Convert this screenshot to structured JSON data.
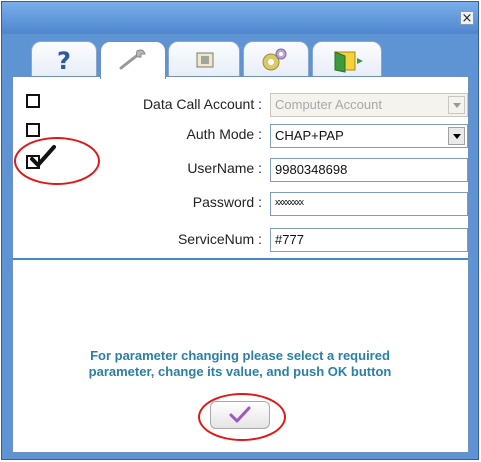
{
  "window": {
    "close_glyph": "×"
  },
  "tabs": [
    {
      "name": "help",
      "icon": "question-icon"
    },
    {
      "name": "settings",
      "icon": "wrench-icon",
      "active": true
    },
    {
      "name": "sim",
      "icon": "card-icon"
    },
    {
      "name": "advanced",
      "icon": "gears-icon"
    },
    {
      "name": "exit",
      "icon": "door-icon"
    }
  ],
  "form": {
    "data_call_account": {
      "label": "Data Call Account :",
      "value": "Computer Account",
      "enabled": false,
      "checked": false
    },
    "auth_mode": {
      "label": "Auth Mode :",
      "value": "CHAP+PAP",
      "enabled": true,
      "checked": false
    },
    "username": {
      "label": "UserName :",
      "value": "9980348698",
      "checked": true
    },
    "password": {
      "label": "Password :",
      "value": "xxxxxxxx"
    },
    "service_num": {
      "label": "ServiceNum :",
      "value": "#777"
    }
  },
  "hint": {
    "line1": "For parameter changing please select a required",
    "line2": "parameter, change its value, and push OK button"
  },
  "ok_button": {
    "icon": "checkmark-icon"
  },
  "colors": {
    "frame": "#5f94d4",
    "hint_text": "#2a7fa6",
    "annotation": "#e01818",
    "check_mark_accent": "#a055c8"
  }
}
